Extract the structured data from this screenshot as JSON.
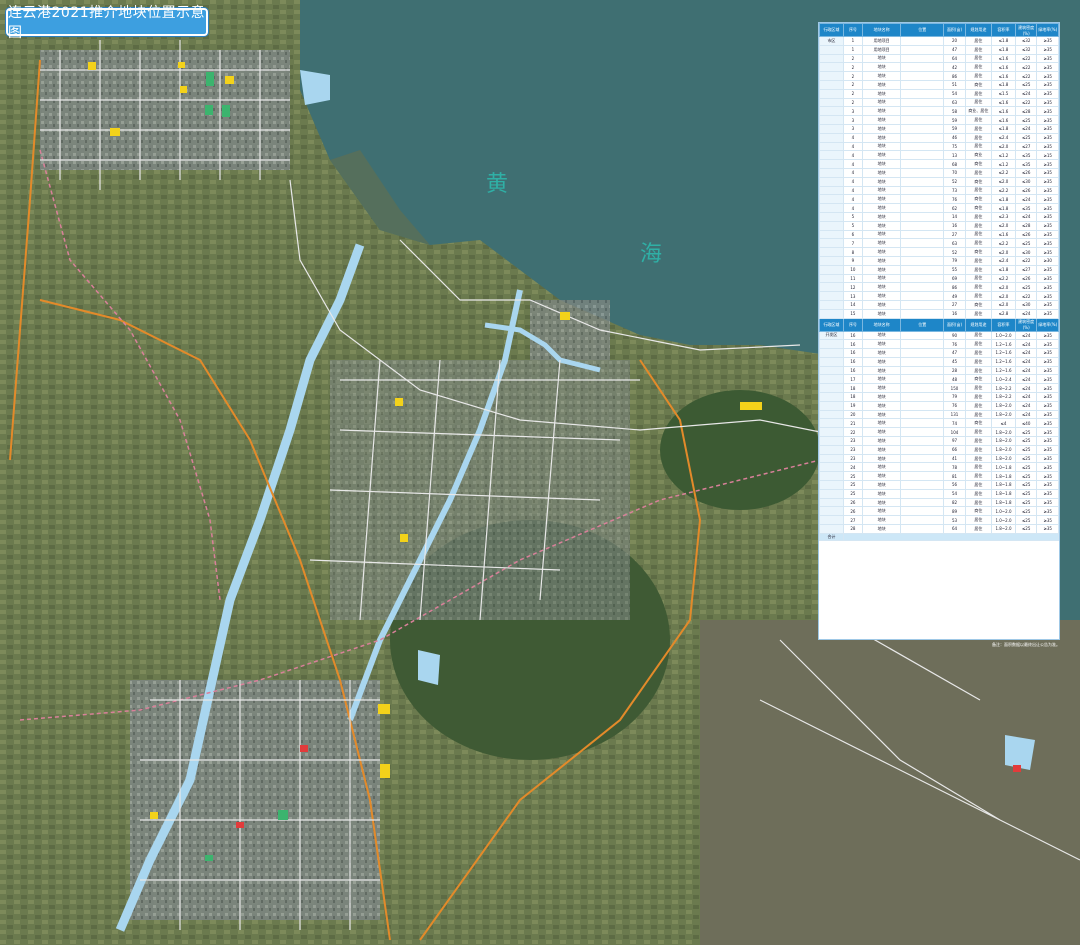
{
  "title": "连云港2021推介地块位置示意图",
  "sea_labels": [
    "黄",
    "海"
  ],
  "table": {
    "header": [
      "行政区域",
      "序号",
      "地块名称",
      "位置",
      "面积(亩)",
      "规划用途",
      "容积率",
      "建筑密度(%)",
      "绿地率(%)"
    ],
    "section1": {
      "region": "市区",
      "rows": [
        [
          "1",
          "用地项目",
          "20",
          "居住",
          "≤1.8",
          "≤32",
          "≥35"
        ],
        [
          "1",
          "用地项目",
          "47",
          "居住",
          "≤1.8",
          "≤32",
          "≥35"
        ],
        [
          "2",
          "地块",
          "64",
          "居住",
          "≤1.6",
          "≤22",
          "≥35"
        ],
        [
          "2",
          "地块",
          "42",
          "居住",
          "≤1.6",
          "≤22",
          "≥35"
        ],
        [
          "2",
          "地块",
          "86",
          "居住",
          "≤1.6",
          "≤22",
          "≥35"
        ],
        [
          "2",
          "地块",
          "51",
          "商住",
          "≤1.8",
          "≤25",
          "≥35"
        ],
        [
          "2",
          "地块",
          "54",
          "居住",
          "≤1.5",
          "≤24",
          "≥35"
        ],
        [
          "2",
          "地块",
          "63",
          "居住",
          "≤1.6",
          "≤22",
          "≥35"
        ],
        [
          "3",
          "地块",
          "58",
          "商业、居住",
          "≤1.6",
          "≤28",
          "≥35"
        ],
        [
          "3",
          "地块",
          "59",
          "居住",
          "≤1.6",
          "≤25",
          "≥35"
        ],
        [
          "3",
          "地块",
          "59",
          "居住",
          "≤1.8",
          "≤24",
          "≥35"
        ],
        [
          "4",
          "地块",
          "46",
          "居住",
          "≤2.4",
          "≤25",
          "≥35"
        ],
        [
          "4",
          "地块",
          "75",
          "居住",
          "≤2.0",
          "≤27",
          "≥35"
        ],
        [
          "4",
          "地块",
          "13",
          "商业",
          "≤1.2",
          "≤35",
          "≥15"
        ],
        [
          "4",
          "地块",
          "68",
          "商住",
          "≤1.2",
          "≤35",
          "≥35"
        ],
        [
          "4",
          "地块",
          "70",
          "居住",
          "≤2.2",
          "≤26",
          "≥35"
        ],
        [
          "4",
          "地块",
          "52",
          "商住",
          "≤2.0",
          "≤30",
          "≥35"
        ],
        [
          "4",
          "地块",
          "73",
          "居住",
          "≤2.2",
          "≤26",
          "≥35"
        ],
        [
          "4",
          "地块",
          "76",
          "商住",
          "≤1.8",
          "≤24",
          "≥35"
        ],
        [
          "4",
          "地块",
          "62",
          "商住",
          "≤1.8",
          "≤35",
          "≥35"
        ],
        [
          "5",
          "地块",
          "14",
          "居住",
          "≤2.3",
          "≤24",
          "≥35"
        ],
        [
          "5",
          "地块",
          "16",
          "居住",
          "≤2.0",
          "≤28",
          "≥35"
        ],
        [
          "6",
          "地块",
          "27",
          "居住",
          "≤1.6",
          "≤26",
          "≥35"
        ],
        [
          "7",
          "地块",
          "63",
          "居住",
          "≤2.2",
          "≤25",
          "≥35"
        ],
        [
          "8",
          "地块",
          "52",
          "商住",
          "≤2.0",
          "≤30",
          "≥35"
        ],
        [
          "9",
          "地块",
          "79",
          "居住",
          "≤2.4",
          "≤22",
          "≥30"
        ],
        [
          "10",
          "地块",
          "55",
          "居住",
          "≤1.8",
          "≤27",
          "≥35"
        ],
        [
          "11",
          "地块",
          "69",
          "居住",
          "≤2.2",
          "≤26",
          "≥35"
        ],
        [
          "12",
          "地块",
          "86",
          "居住",
          "≤2.0",
          "≤25",
          "≥35"
        ],
        [
          "13",
          "地块",
          "49",
          "居住",
          "≤2.0",
          "≤22",
          "≥35"
        ],
        [
          "14",
          "地块",
          "27",
          "商住",
          "≤2.0",
          "≤30",
          "≥35"
        ],
        [
          "15",
          "地块",
          "16",
          "居住",
          "≤2.8",
          "≤24",
          "≥35"
        ]
      ]
    },
    "section2": {
      "region": "开发区",
      "rows": [
        [
          "16",
          "地块",
          "90",
          "居住",
          "1.0~2.0",
          "≤24",
          "≥35"
        ],
        [
          "16",
          "地块",
          "76",
          "居住",
          "1.2~1.6",
          "≤24",
          "≥35"
        ],
        [
          "16",
          "地块",
          "47",
          "居住",
          "1.2~1.6",
          "≤24",
          "≥35"
        ],
        [
          "16",
          "地块",
          "45",
          "居住",
          "1.2~1.6",
          "≤24",
          "≥35"
        ],
        [
          "16",
          "地块",
          "28",
          "居住",
          "1.2~1.6",
          "≤24",
          "≥35"
        ],
        [
          "17",
          "地块",
          "48",
          "商住",
          "1.0~2.4",
          "≤24",
          "≥35"
        ],
        [
          "18",
          "地块",
          "150",
          "居住",
          "1.8~2.2",
          "≤24",
          "≥35"
        ],
        [
          "18",
          "地块",
          "79",
          "居住",
          "1.8~2.2",
          "≤24",
          "≥35"
        ],
        [
          "19",
          "地块",
          "76",
          "居住",
          "1.8~2.0",
          "≤24",
          "≥35"
        ],
        [
          "20",
          "地块",
          "131",
          "居住",
          "1.8~2.0",
          "≤24",
          "≥35"
        ],
        [
          "21",
          "地块",
          "74",
          "商住",
          "≤4",
          "≤40",
          "≥35"
        ],
        [
          "22",
          "地块",
          "104",
          "居住",
          "1.8~2.0",
          "≤25",
          "≥35"
        ],
        [
          "23",
          "地块",
          "97",
          "居住",
          "1.8~2.0",
          "≤25",
          "≥35"
        ],
        [
          "23",
          "地块",
          "66",
          "居住",
          "1.8~2.0",
          "≤25",
          "≥35"
        ],
        [
          "23",
          "地块",
          "41",
          "居住",
          "1.8~2.0",
          "≤25",
          "≥35"
        ],
        [
          "24",
          "地块",
          "78",
          "居住",
          "1.0~1.8",
          "≤25",
          "≥35"
        ],
        [
          "25",
          "地块",
          "81",
          "居住",
          "1.8~1.8",
          "≤25",
          "≥35"
        ],
        [
          "25",
          "地块",
          "56",
          "居住",
          "1.8~1.8",
          "≤25",
          "≥35"
        ],
        [
          "25",
          "地块",
          "54",
          "居住",
          "1.8~1.8",
          "≤25",
          "≥35"
        ],
        [
          "26",
          "地块",
          "82",
          "居住",
          "1.8~1.8",
          "≤25",
          "≥35"
        ],
        [
          "26",
          "地块",
          "89",
          "商住",
          "1.0~2.0",
          "≤25",
          "≥35"
        ],
        [
          "27",
          "地块",
          "53",
          "居住",
          "1.0~2.0",
          "≤25",
          "≥35"
        ],
        [
          "28",
          "地块",
          "64",
          "居住",
          "1.8~2.0",
          "≤25",
          "≥35"
        ]
      ]
    },
    "total_label": "合计",
    "note": "备注：面积数据以最终出让公告为准。"
  },
  "colors": {
    "sea": "#3f6f72",
    "river": "#a9d6ef",
    "road": "#e8e8e8",
    "highway": "#e38a2a",
    "rail": "#d9809a",
    "plot_residential": "#f3d21a",
    "plot_green": "#3cb46e",
    "plot_red": "#e23b3b",
    "table_header": "#1e86c8",
    "title_bg": "#3d9fe0"
  }
}
